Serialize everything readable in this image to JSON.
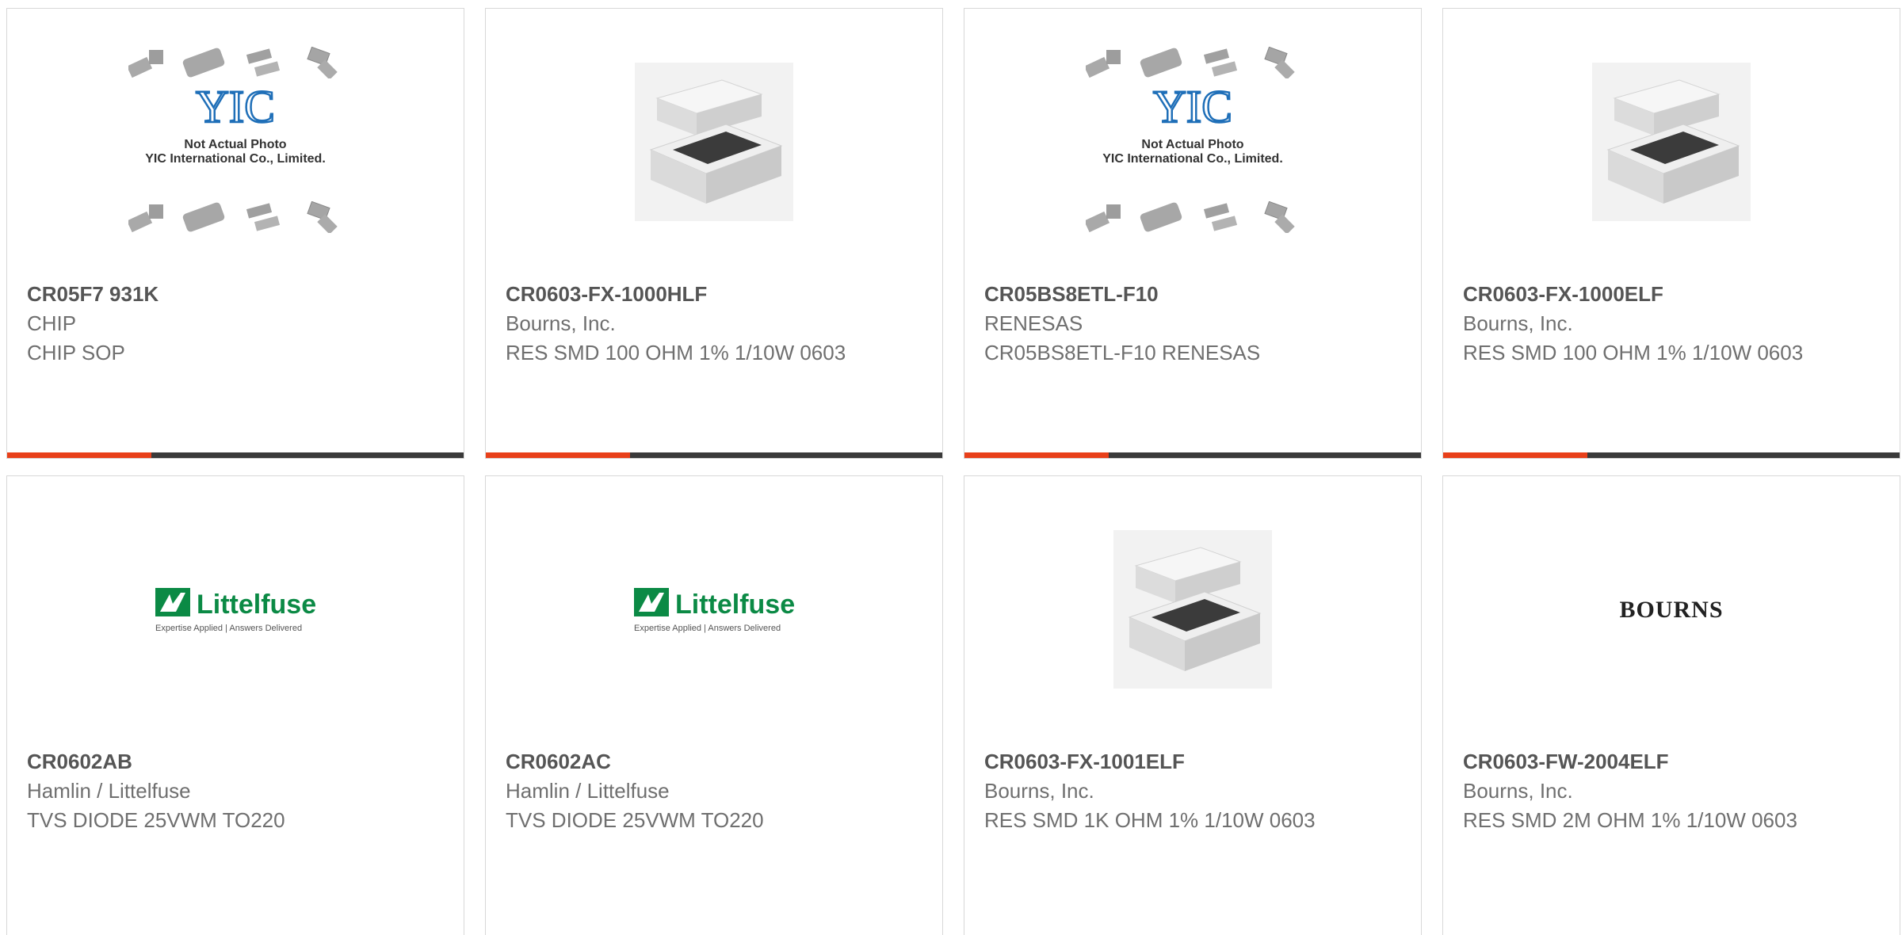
{
  "products": [
    {
      "part": "CR05F7 931K",
      "manufacturer": "CHIP",
      "description": "CHIP SOP",
      "image": "yic-not-actual-photo",
      "image_caption_line1": "Not Actual Photo",
      "image_caption_line2": "YIC International Co., Limited.",
      "image_logo": "YIC"
    },
    {
      "part": "CR0603-FX-1000HLF",
      "manufacturer": "Bourns, Inc.",
      "description": "RES SMD 100 OHM 1% 1/10W 0603",
      "image": "chip-resistor-photo"
    },
    {
      "part": "CR05BS8ETL-F10",
      "manufacturer": "RENESAS",
      "description": "CR05BS8ETL-F10 RENESAS",
      "image": "yic-not-actual-photo",
      "image_caption_line1": "Not Actual Photo",
      "image_caption_line2": "YIC International Co., Limited.",
      "image_logo": "YIC"
    },
    {
      "part": "CR0603-FX-1000ELF",
      "manufacturer": "Bourns, Inc.",
      "description": "RES SMD 100 OHM 1% 1/10W 0603",
      "image": "chip-resistor-photo"
    },
    {
      "part": "CR0602AB",
      "manufacturer": "Hamlin / Littelfuse",
      "description": "TVS DIODE 25VWM TO220",
      "image": "littelfuse-logo",
      "logo_text": "Littelfuse",
      "logo_tagline": "Expertise Applied | Answers Delivered"
    },
    {
      "part": "CR0602AC",
      "manufacturer": "Hamlin / Littelfuse",
      "description": "TVS DIODE 25VWM TO220",
      "image": "littelfuse-logo",
      "logo_text": "Littelfuse",
      "logo_tagline": "Expertise Applied | Answers Delivered"
    },
    {
      "part": "CR0603-FX-1001ELF",
      "manufacturer": "Bourns, Inc.",
      "description": "RES SMD 1K OHM 1% 1/10W 0603",
      "image": "chip-resistor-photo"
    },
    {
      "part": "CR0603-FW-2004ELF",
      "manufacturer": "Bourns, Inc.",
      "description": "RES SMD 2M OHM 1% 1/10W 0603",
      "image": "bourns-logo",
      "logo_text": "BOURNS"
    }
  ],
  "colors": {
    "accent": "#e8401a",
    "bar": "#3a3a3a",
    "littelfuse_green": "#0b8a45",
    "yic_blue": "#1f6fb8"
  }
}
